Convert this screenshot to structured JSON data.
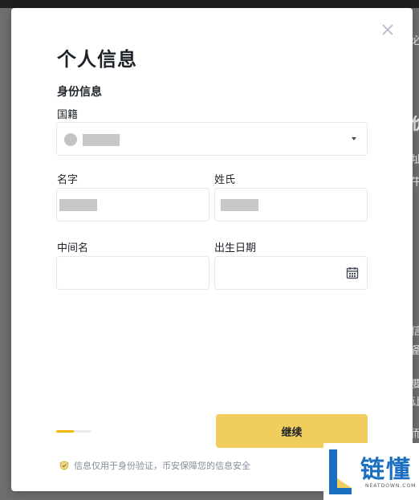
{
  "modal": {
    "title": "个人信息",
    "section_title": "身份信息",
    "nationality": {
      "label": "国籍",
      "value": ""
    },
    "first_name": {
      "label": "名字",
      "value": ""
    },
    "last_name": {
      "label": "姓氏",
      "value": ""
    },
    "middle_name": {
      "label": "中间名",
      "value": "",
      "placeholder": ""
    },
    "birth_date": {
      "label": "出生日期",
      "value": "",
      "placeholder": ""
    },
    "continue_label": "继续",
    "progress": 0.5,
    "footer_note": "信息仅用于身份验证，币安保障您的信息安全"
  },
  "icons": {
    "close": "close-icon",
    "dropdown": "chevron-down-icon",
    "calendar": "calendar-icon",
    "shield": "shield-check-icon"
  },
  "colors": {
    "accent": "#f0cd5d",
    "progress_fill": "#f0b90b",
    "text_primary": "#1e2329",
    "text_secondary": "#848e9c",
    "border": "#e6e8ea"
  },
  "watermark": {
    "text": "链懂",
    "sub_text": "NEATDOWN.COM"
  }
}
